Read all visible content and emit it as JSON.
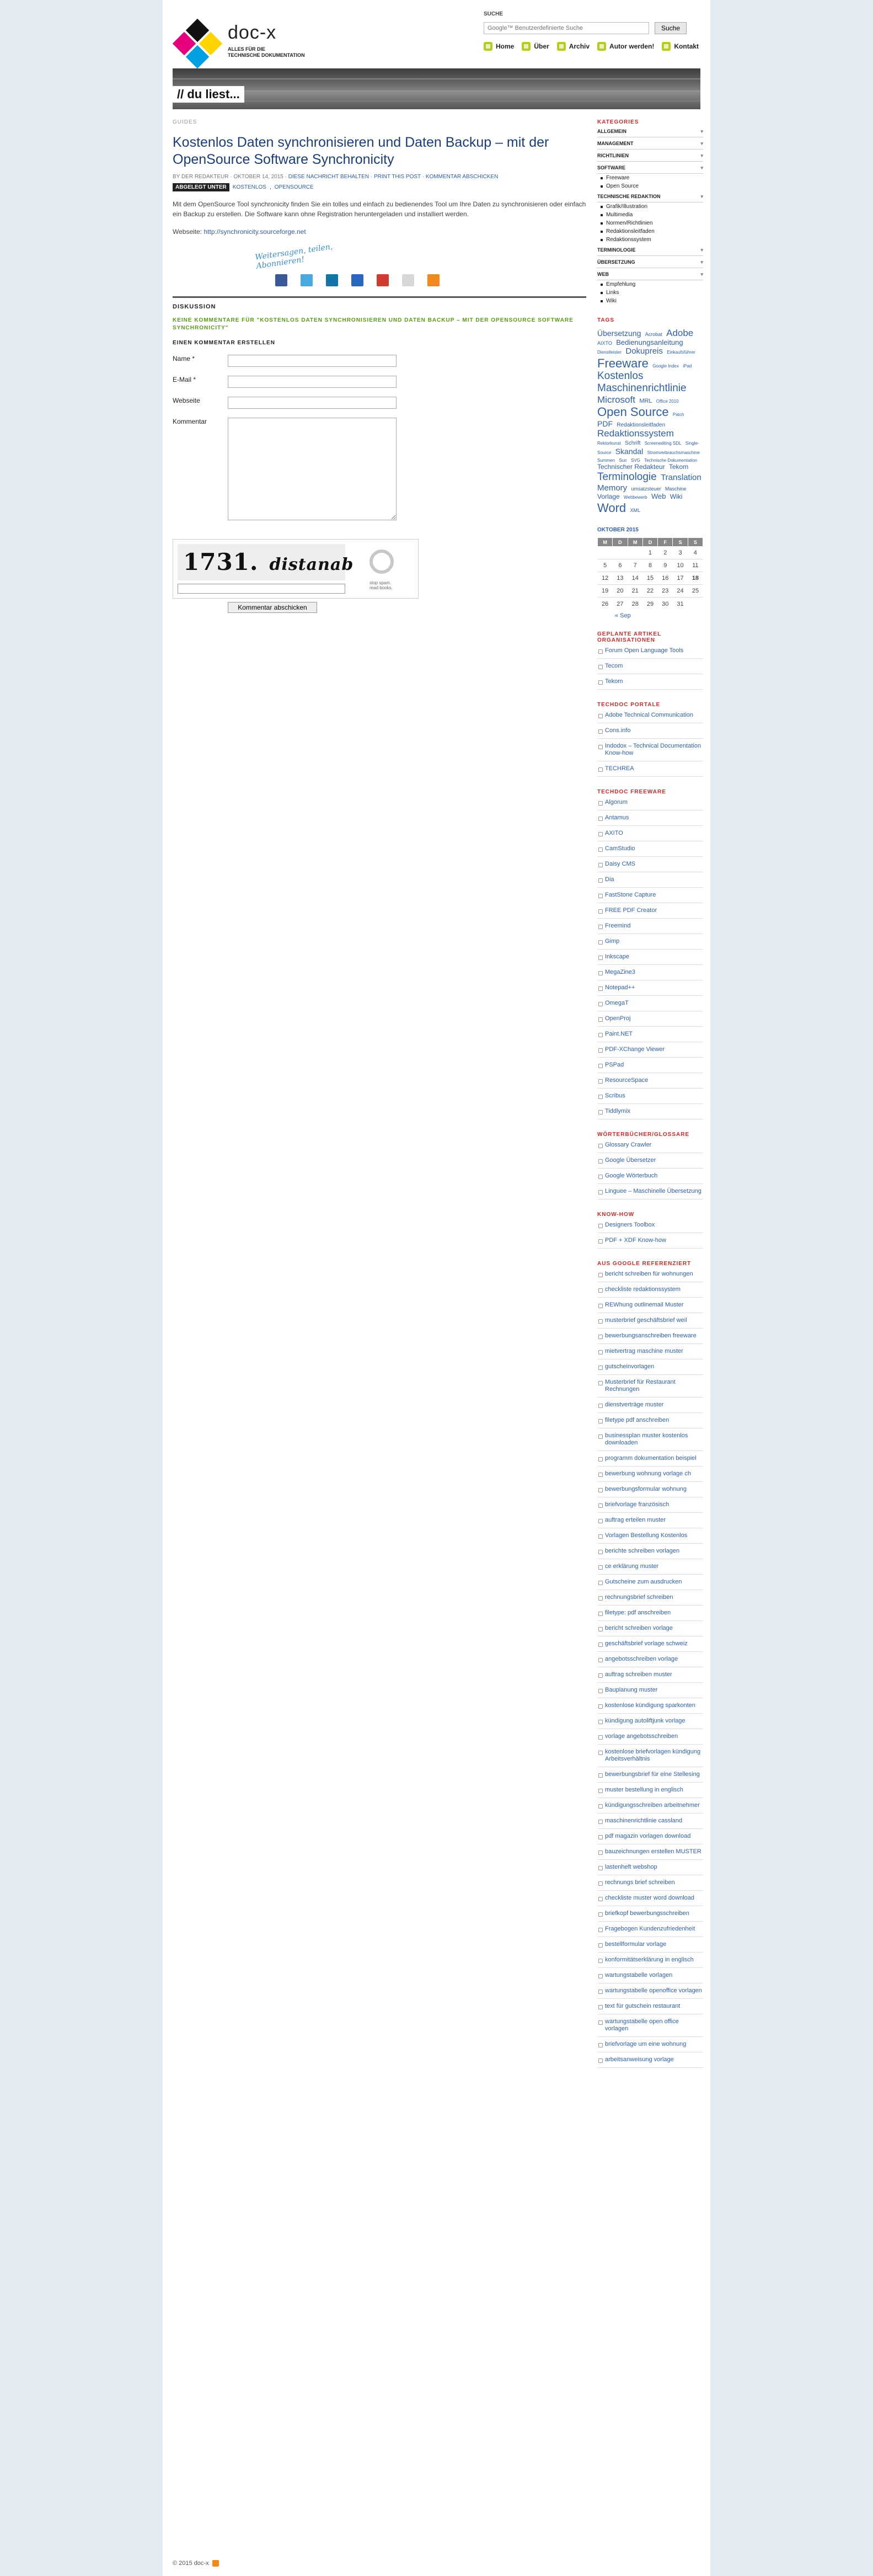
{
  "site": {
    "title": "doc-x",
    "tagline_1": "Alles für die",
    "tagline_2": "technische Dokumentation"
  },
  "search": {
    "label": "SUCHE",
    "placeholder": "Google™ Benutzerdefinierte Suche",
    "button": "Suche"
  },
  "topnav": [
    "Home",
    "Über",
    "Archiv",
    "Autor werden!",
    "Kontakt"
  ],
  "banner": {
    "text": "// du liest..."
  },
  "post": {
    "breadcrumb": "GUIDES",
    "title": "Kostenlos Daten synchronisieren und Daten Backup – mit der OpenSource Software Synchronicity",
    "meta_by": "BY DER REDAKTEUR",
    "meta_date": "OKTOBER 14, 2015",
    "meta_cat": "DIESE NACHRICHT BEHALTEN",
    "meta_print": "PRINT THIS POST",
    "meta_comments": "KOMMENTAR ABSCHICKEN",
    "tags_label": "ABGELEGT UNTER",
    "tags": [
      "KOSTENLOS",
      "OPENSOURCE"
    ],
    "paragraph": "Mit dem OpenSource Tool synchronicity finden Sie ein tolles und einfach zu bedienendes Tool um Ihre Daten zu synchronisieren oder einfach ein Backup zu erstellen. Die Software kann ohne Registration heruntergeladen und installiert werden.",
    "website_label": "Webseite:",
    "website_url": "http://synchronicity.sourceforge.net",
    "share_handwriting_1": "Weitersagen, teilen,",
    "share_handwriting_2": "Abonnieren!"
  },
  "discussion": {
    "heading": "DISKUSSION",
    "no_comments": "KEINE KOMMENTARE FÜR \"KOSTENLOS DATEN SYNCHRONISIEREN UND DATEN BACKUP – MIT DER OPENSOURCE SOFTWARE SYNCHRONICITY\"",
    "create_heading": "EINEN KOMMENTAR ERSTELLEN",
    "fields": {
      "name": "Name *",
      "email": "E-Mail *",
      "website": "Webseite",
      "comment": "Kommentar"
    },
    "captcha_num": "1731.",
    "captcha_word": "distanab",
    "captcha_note_1": "stop spam.",
    "captcha_note_2": "read books.",
    "submit": "Kommentar abschicken"
  },
  "sidebar": {
    "categories_heading": "KATEGORIES",
    "categories": [
      {
        "label": "ALLGEMEIN",
        "subs": []
      },
      {
        "label": "MANAGEMENT",
        "subs": []
      },
      {
        "label": "RICHTLINIEN",
        "subs": []
      },
      {
        "label": "SOFTWARE",
        "subs": [
          "Freeware",
          "Open Source"
        ]
      },
      {
        "label": "TECHNISCHE REDAKTION",
        "subs": [
          "Grafik/Illustration",
          "Multimedia",
          "Normen/Richtlinien",
          "Redaktionsleitfaden",
          "Redaktionssystem"
        ]
      },
      {
        "label": "TERMINOLOGIE",
        "subs": []
      },
      {
        "label": "ÜBERSETZUNG",
        "subs": []
      },
      {
        "label": "WEB",
        "subs": [
          "Empfehlung",
          "Links",
          "Wiki"
        ]
      }
    ],
    "tags_heading": "TAGS",
    "tagcloud": [
      {
        "t": "Übersetzung",
        "s": 14
      },
      {
        "t": "Acrobat",
        "s": 9
      },
      {
        "t": "Adobe",
        "s": 17
      },
      {
        "t": "AIXTO",
        "s": 9
      },
      {
        "t": "Bedienungsanleitung",
        "s": 13
      },
      {
        "t": "Dienstleister",
        "s": 8
      },
      {
        "t": "Dokupreis",
        "s": 15
      },
      {
        "t": "Einkaufsführer",
        "s": 8
      },
      {
        "t": "Freeware",
        "s": 22
      },
      {
        "t": "Google Index",
        "s": 8
      },
      {
        "t": "iPad",
        "s": 8
      },
      {
        "t": "Kostenlos",
        "s": 19
      },
      {
        "t": "Maschinenrichtlinie",
        "s": 19
      },
      {
        "t": "Microsoft",
        "s": 17
      },
      {
        "t": "MRL",
        "s": 11
      },
      {
        "t": "Office 2010",
        "s": 8
      },
      {
        "t": "Open Source",
        "s": 22
      },
      {
        "t": "Patch",
        "s": 8
      },
      {
        "t": "PDF",
        "s": 14
      },
      {
        "t": "Redaktionsleitfaden",
        "s": 10
      },
      {
        "t": "Redaktionssystem",
        "s": 17
      },
      {
        "t": "Rektorkunst",
        "s": 8
      },
      {
        "t": "Schrift",
        "s": 10
      },
      {
        "t": "Screenediting SDL",
        "s": 8
      },
      {
        "t": "Single-Source",
        "s": 8
      },
      {
        "t": "Skandal",
        "s": 14
      },
      {
        "t": "Stromverbrauchsmaschine",
        "s": 8
      },
      {
        "t": "Summen",
        "s": 8
      },
      {
        "t": "Sun",
        "s": 8
      },
      {
        "t": "SVG",
        "s": 8
      },
      {
        "t": "Technische Dokumentation",
        "s": 8
      },
      {
        "t": "Technischer Redakteur",
        "s": 12
      },
      {
        "t": "Tekom",
        "s": 12
      },
      {
        "t": "Terminologie",
        "s": 19
      },
      {
        "t": "Translation Memory",
        "s": 15
      },
      {
        "t": "umsatzsteuer",
        "s": 9
      },
      {
        "t": "Maschine",
        "s": 9
      },
      {
        "t": "Vorlage",
        "s": 12
      },
      {
        "t": "Wettbewerb",
        "s": 8
      },
      {
        "t": "Web",
        "s": 13
      },
      {
        "t": "Wiki",
        "s": 12
      },
      {
        "t": "Word",
        "s": 22
      },
      {
        "t": "XML",
        "s": 9
      }
    ],
    "calendar_heading": "OKTOBER 2015",
    "calendar_days": [
      "M",
      "D",
      "M",
      "D",
      "F",
      "S",
      "S"
    ],
    "calendar_weeks": [
      [
        "",
        "",
        "",
        "1",
        "2",
        "3",
        "4"
      ],
      [
        "5",
        "6",
        "7",
        "8",
        "9",
        "10",
        "11"
      ],
      [
        "12",
        "13",
        "14",
        "15",
        "16",
        "17",
        "18"
      ],
      [
        "19",
        "20",
        "21",
        "22",
        "23",
        "24",
        "25"
      ],
      [
        "26",
        "27",
        "28",
        "29",
        "30",
        "31",
        ""
      ]
    ],
    "calendar_prev": "« Sep",
    "planned_heading": "GEPLANTE ARTIKEL",
    "groups": [
      {
        "heading": "ORGANISATIONEN",
        "links": [
          "Forum Open Language Tools",
          "Tecom",
          "Tekom"
        ]
      },
      {
        "heading": "TECHDOC PORTALE",
        "links": [
          "Adobe Technical Communication",
          "Cons.info",
          "Indodox – Technical Documentation Know-how",
          "TECHREA"
        ]
      },
      {
        "heading": "TECHDOC FREEWARE",
        "links": [
          "Algorum",
          "Antamus",
          "AXITO",
          "CamStudio",
          "Daisy CMS",
          "Dia",
          "FastStone Capture",
          "FREE PDF Creator",
          "Freemind",
          "Gimp",
          "Inkscape",
          "MegaZine3",
          "Notepad++",
          "OmegaT",
          "OpenProj",
          "Paint.NET",
          "PDF-XChange Viewer",
          "PSPad",
          "ResourceSpace",
          "Scribus",
          "Tiddlymix"
        ]
      },
      {
        "heading": "WÖRTERBÜCHER/GLOSSARE",
        "links": [
          "Glossary Crawler",
          "Google Übersetzer",
          "Google Wörterbuch",
          "Linguee – Maschinelle Übersetzung"
        ]
      },
      {
        "heading": "KNOW-HOW",
        "links": [
          "Designers Toolbox",
          "PDF + XDF Know-how"
        ]
      },
      {
        "heading": "AUS GOOGLE REFERENZIERT",
        "links": [
          "bericht schreiben für wohnungen",
          "checkliste redaktionssystem",
          "REWhung outlinemail Muster",
          "musterbrief geschäftsbrief weil",
          "bewerbungsanschreiben freeware",
          "mietvertrag maschine muster",
          "gutscheinvorlagen",
          "Musterbrief für Restaurant Rechnungen",
          "dienstverträge muster",
          "filetype pdf anschreiben",
          "businessplan muster kostenlos downloaden",
          "programm dokumentation beispiel",
          "bewerbung wohnung vorlage ch",
          "bewerbungsformular wohnung",
          "briefvorlage französisch",
          "auftrag erteilen muster",
          "Vorlagen Bestellung Kostenlos",
          "berichte schreiben vorlagen",
          "ce erklärung muster",
          "Gutscheine zum ausdrucken",
          "rechnungsbrief schreiben",
          "filetype: pdf anschreiben",
          "bericht schreiben vorlage",
          "geschäftsbrief vorlage schweiz",
          "angebotsschreiben vorlage",
          "auftrag schreiben muster",
          "Bauplanung muster",
          "kostenlose kündigung sparkonten",
          "kündigung autoliftjunk vorlage",
          "vorlage angebotsschreiben",
          "kostenlose briefvorlagen kündigung Arbeitsverhältnis",
          "bewerbungsbrief für eine Stellesing",
          "muster bestellung in englisch",
          "kündigungsschreiben arbeitnehmer",
          "maschinenrichtlinie cassland",
          "pdf magazin vorlagen download",
          "bauzeichnungen erstellen MUSTER",
          "lastenheft webshop",
          "rechnungs brief schreiben",
          "checkliste muster word download",
          "briefkopf bewerbungsschreiben",
          "Fragebogen Kundenzufriedenheit",
          "bestellformular vorlage",
          "konformitätserklärung in englisch",
          "wartungstabelle vorlagen",
          "wartungstabelle openoffice vorlagen",
          "text für gutschein restaurant",
          "wartungstabelle open office vorlagen",
          "briefvorlage um eine wohnung",
          "arbeitsanweisung vorlage"
        ]
      }
    ]
  },
  "footer": {
    "copyright": "© 2015 doc-x"
  },
  "colors": {
    "accent": "#b6cd1f",
    "link": "#2f5fa8",
    "sidebar_heading": "#cc2a2a",
    "title": "#1a3d7a"
  },
  "icons": [
    "search-icon",
    "home-icon",
    "info-icon",
    "archive-icon",
    "author-icon",
    "contact-icon",
    "facebook-icon",
    "twitter-icon",
    "linkedin-icon",
    "delicious-icon",
    "google-icon",
    "email-icon",
    "rss-icon"
  ]
}
